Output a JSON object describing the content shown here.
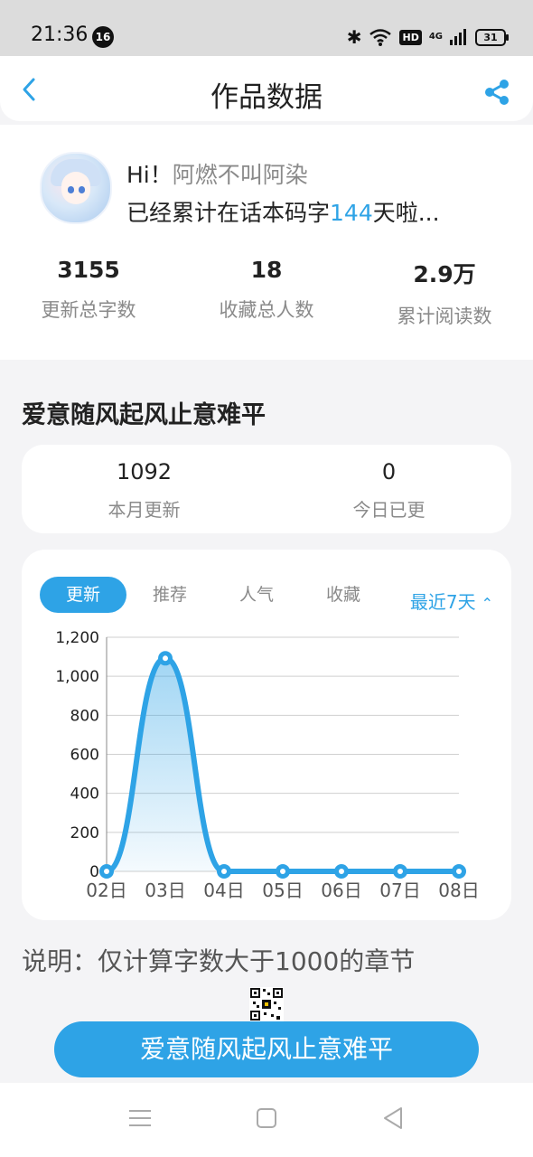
{
  "status_bar": {
    "time": "21:36",
    "notification_count": "16",
    "hd": "HD",
    "network": "4G",
    "battery": "31"
  },
  "nav": {
    "title": "作品数据",
    "back_icon": "chevron-left-icon",
    "share_icon": "share-icon"
  },
  "profile": {
    "greeting": "Hi！",
    "username": "阿燃不叫阿染",
    "summary_prefix": "已经累计在话本码字",
    "days": "144",
    "summary_suffix": "天啦...",
    "stats": [
      {
        "value": "3155",
        "label": "更新总字数"
      },
      {
        "value": "18",
        "label": "收藏总人数"
      },
      {
        "value": "2.9万",
        "label": "累计阅读数"
      }
    ]
  },
  "work": {
    "title": "爱意随风起风止意难平",
    "month_update_value": "1092",
    "month_update_label": "本月更新",
    "today_value": "0",
    "today_label": "今日已更"
  },
  "chart_tabs": [
    "更新",
    "推荐",
    "人气",
    "收藏"
  ],
  "active_tab": "更新",
  "range_label": "最近7天",
  "chart_data": {
    "type": "area",
    "categories": [
      "02日",
      "03日",
      "04日",
      "05日",
      "06日",
      "07日",
      "08日"
    ],
    "values": [
      0,
      1092,
      0,
      0,
      0,
      0,
      0
    ],
    "y_ticks": [
      "0",
      "200",
      "400",
      "600",
      "800",
      "1,000",
      "1,200"
    ],
    "ylim": [
      0,
      1200
    ],
    "grid": true,
    "line_color": "#2ea3e6"
  },
  "note": "说明：仅计算字数大于1000的章节",
  "cta_label": "爱意随风起风止意难平",
  "colors": {
    "accent": "#2ea3e6"
  }
}
